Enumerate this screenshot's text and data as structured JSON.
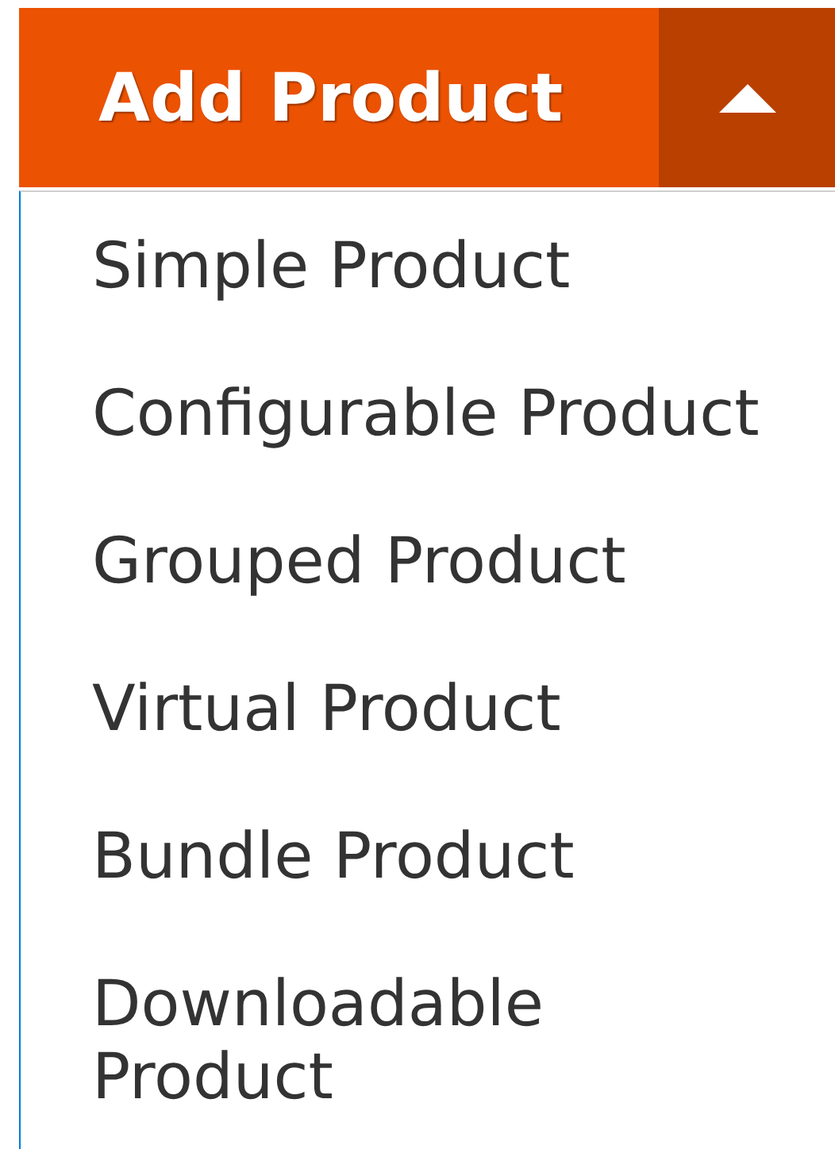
{
  "split_button": {
    "label": "Add Product",
    "expanded": true
  },
  "menu": {
    "items": [
      {
        "label": "Simple Product"
      },
      {
        "label": "Configurable Product"
      },
      {
        "label": "Grouped Product"
      },
      {
        "label": "Virtual Product"
      },
      {
        "label": "Bundle Product"
      },
      {
        "label": "Downloadable Product"
      }
    ]
  }
}
